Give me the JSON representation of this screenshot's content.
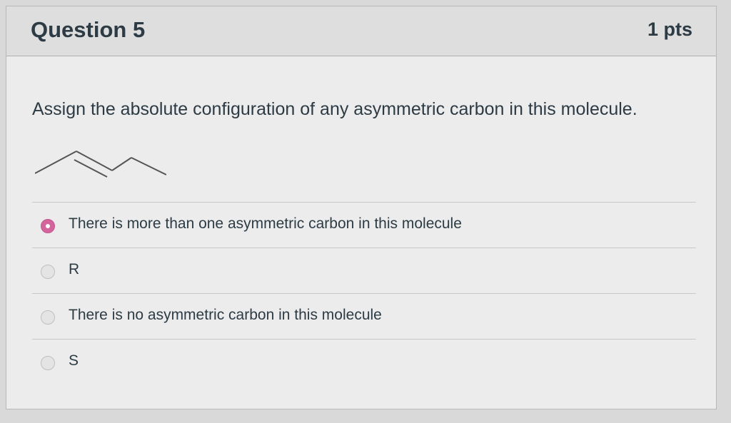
{
  "question": {
    "title": "Question 5",
    "points": "1 pts",
    "prompt": "Assign the absolute configuration of any asymmetric carbon in this molecule.",
    "figure": "molecule-structure-skeletal",
    "answers": [
      {
        "label": "There is more than one asymmetric carbon in this molecule",
        "selected": true
      },
      {
        "label": "R",
        "selected": false
      },
      {
        "label": "There is no asymmetric carbon in this molecule",
        "selected": false
      },
      {
        "label": "S",
        "selected": false
      }
    ]
  },
  "colors": {
    "selected_radio": "#d4649c",
    "text": "#2d3b45"
  }
}
